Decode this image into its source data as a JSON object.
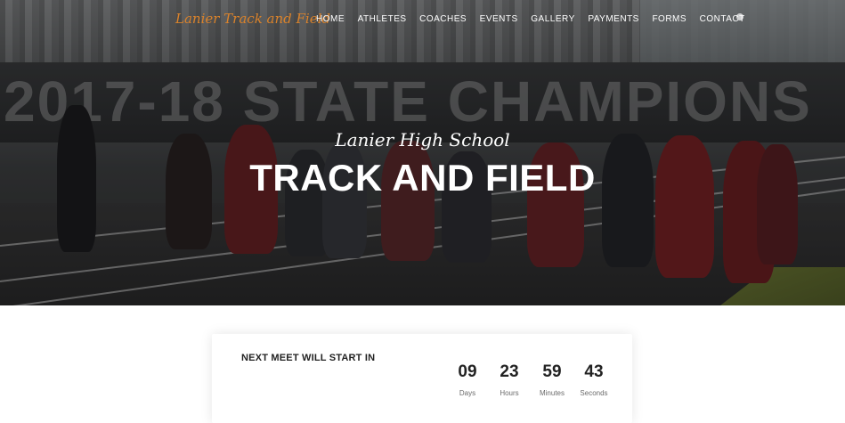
{
  "brand": {
    "logo_text": "Lanier Track and Field"
  },
  "nav": {
    "items": [
      "HOME",
      "ATHLETES",
      "COACHES",
      "EVENTS",
      "GALLERY",
      "PAYMENTS",
      "FORMS",
      "CONTACT"
    ]
  },
  "hero": {
    "subtitle": "Lanier High School",
    "title": "TRACK AND FIELD",
    "banner_text": "2017-18 STATE CHAMPIONS"
  },
  "countdown": {
    "label": "NEXT MEET WILL START IN",
    "units": [
      {
        "value": "09",
        "label": "Days"
      },
      {
        "value": "23",
        "label": "Hours"
      },
      {
        "value": "59",
        "label": "Minutes"
      },
      {
        "value": "43",
        "label": "Seconds"
      }
    ]
  },
  "colors": {
    "logo": "#d9822b",
    "nav_text": "#ffffff",
    "card_text": "#222222",
    "unit_label": "#6b6b6b"
  }
}
